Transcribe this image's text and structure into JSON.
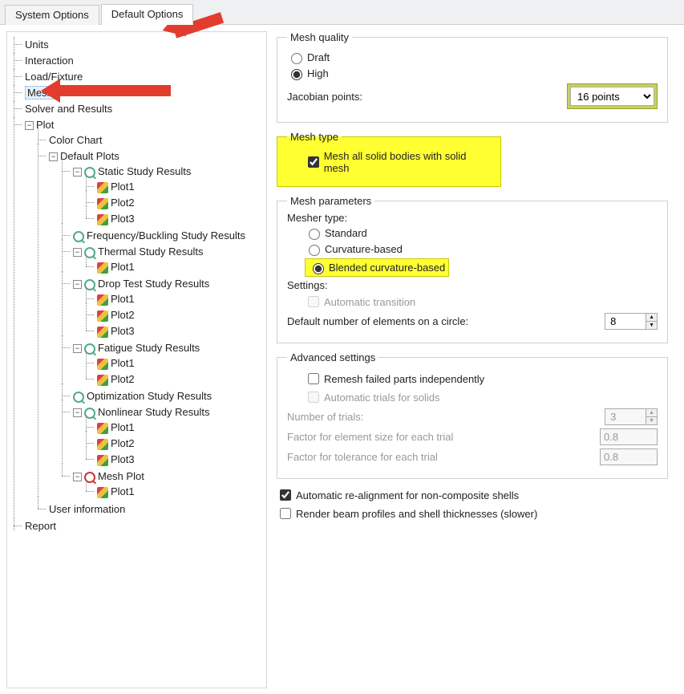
{
  "tabs": {
    "system": "System Options",
    "default": "Default Options"
  },
  "tree": {
    "units": "Units",
    "interaction": "Interaction",
    "loadfixture": "Load/Fixture",
    "mesh": "Mesh",
    "solver": "Solver and Results",
    "plot": "Plot",
    "colorchart": "Color Chart",
    "defaultplots": "Default Plots",
    "static": "Static Study Results",
    "thermal": "Thermal Study Results",
    "droptest": "Drop Test Study Results",
    "freqbuck": "Frequency/Buckling Study Results",
    "fatigue": "Fatigue Study Results",
    "optimization": "Optimization Study Results",
    "nonlinear": "Nonlinear Study Results",
    "meshplot": "Mesh Plot",
    "plot1": "Plot1",
    "plot2": "Plot2",
    "plot3": "Plot3",
    "userinfo": "User information",
    "report": "Report"
  },
  "quality": {
    "legend": "Mesh quality",
    "draft": "Draft",
    "high": "High",
    "jacobian_label": "Jacobian points:",
    "jacobian_value": "16 points"
  },
  "type": {
    "legend": "Mesh type",
    "solid": "Mesh all solid bodies with solid mesh"
  },
  "params": {
    "legend": "Mesh parameters",
    "meshertype": "Mesher type:",
    "std": "Standard",
    "curv": "Curvature-based",
    "blend": "Blended curvature-based",
    "settings": "Settings:",
    "autotrans": "Automatic transition",
    "defcirc": "Default number of elements on a circle:",
    "defcirc_val": "8"
  },
  "adv": {
    "legend": "Advanced settings",
    "remesh": "Remesh failed parts independently",
    "autotrials": "Automatic trials for solids",
    "numtrials": "Number of trials:",
    "numtrials_val": "3",
    "factsize": "Factor for element size for each trial",
    "factsize_val": "0.8",
    "facttol": "Factor for tolerance for each trial",
    "facttol_val": "0.8"
  },
  "bottom": {
    "autoalign": "Automatic re-alignment for non-composite shells",
    "render": "Render beam profiles and shell thicknesses (slower)"
  }
}
